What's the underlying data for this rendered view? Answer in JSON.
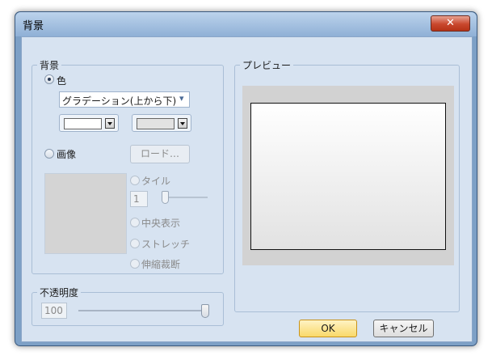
{
  "window": {
    "title": "背景",
    "close_glyph": "✕"
  },
  "background_group": {
    "legend": "背景",
    "color_radio": {
      "label": "色",
      "checked": true
    },
    "gradient_select": {
      "value": "グラデーション(上から下)",
      "arrow": "▾"
    },
    "color_swatch_1": "#ffffff",
    "color_swatch_2": "#e2e2e2",
    "image_radio": {
      "label": "画像",
      "checked": false
    },
    "load_button": "ロード…",
    "tile_radio": "タイル",
    "tile_value": "1",
    "center_radio": "中央表示",
    "stretch_radio": "ストレッチ",
    "scale_radio": "伸縮裁断"
  },
  "opacity_group": {
    "legend": "不透明度",
    "value": "100",
    "slider_fraction": 1.0
  },
  "preview_group": {
    "legend": "プレビュー"
  },
  "buttons": {
    "ok": "OK",
    "cancel": "キャンセル"
  },
  "colors": {
    "accent_ok": "#fbe08a",
    "titlebar": "#9db9dc",
    "close": "#c9472d"
  }
}
